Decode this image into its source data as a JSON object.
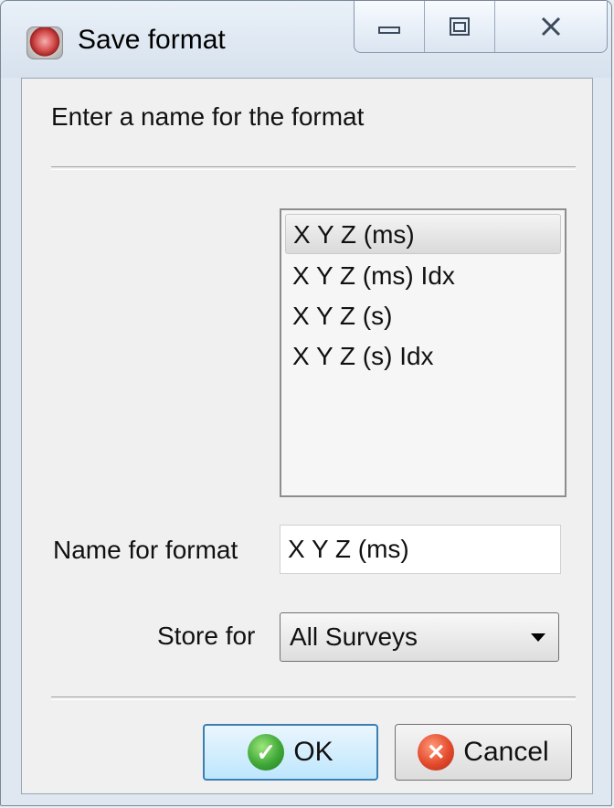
{
  "window": {
    "title": "Save format",
    "icons": {
      "app": "od-app-icon",
      "minimize": "minimize-icon",
      "maximize": "maximize-icon",
      "close": "close-icon"
    }
  },
  "dialog": {
    "prompt": "Enter a name for the format",
    "formats": [
      "X Y Z (ms)",
      "X Y Z (ms) Idx",
      "X Y Z (s)",
      "X Y Z (s) Idx"
    ],
    "selected_index": 0,
    "name_label": "Name for format",
    "name_value": "X Y Z (ms)",
    "store_label": "Store for",
    "store_value": "All Surveys",
    "ok_label": "OK",
    "cancel_label": "Cancel",
    "ok_icon": "check-circle-icon",
    "cancel_icon": "x-circle-icon"
  }
}
